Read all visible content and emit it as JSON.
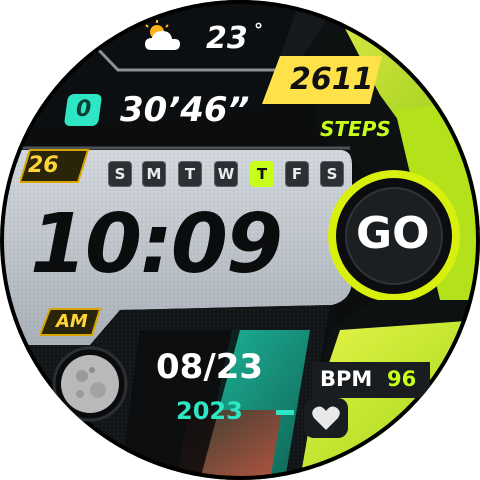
{
  "weather": {
    "temperature": "23",
    "unit": "°",
    "icon": "partly-cloudy-icon"
  },
  "timer": {
    "badge": "0",
    "value": "30’46”"
  },
  "steps": {
    "value": "2611",
    "label": "STEPS"
  },
  "date_day": "26",
  "weekdays": [
    {
      "label": "S",
      "active": false
    },
    {
      "label": "M",
      "active": false
    },
    {
      "label": "T",
      "active": false
    },
    {
      "label": "W",
      "active": false
    },
    {
      "label": "T",
      "active": true
    },
    {
      "label": "F",
      "active": false
    },
    {
      "label": "S",
      "active": false
    }
  ],
  "time": {
    "value": "10:09",
    "ampm": "AM"
  },
  "go_button": {
    "label": "GO"
  },
  "date": {
    "month_day": "08/23",
    "year": "2023"
  },
  "heart_rate": {
    "label": "BPM",
    "value": "96",
    "icon": "heart-icon"
  },
  "moon_phase": {
    "icon": "full-moon-icon"
  },
  "colors": {
    "accent": "#c6ff1a",
    "teal": "#2ee6c3",
    "yellow": "#ffe14a",
    "gold": "#d8a400"
  }
}
